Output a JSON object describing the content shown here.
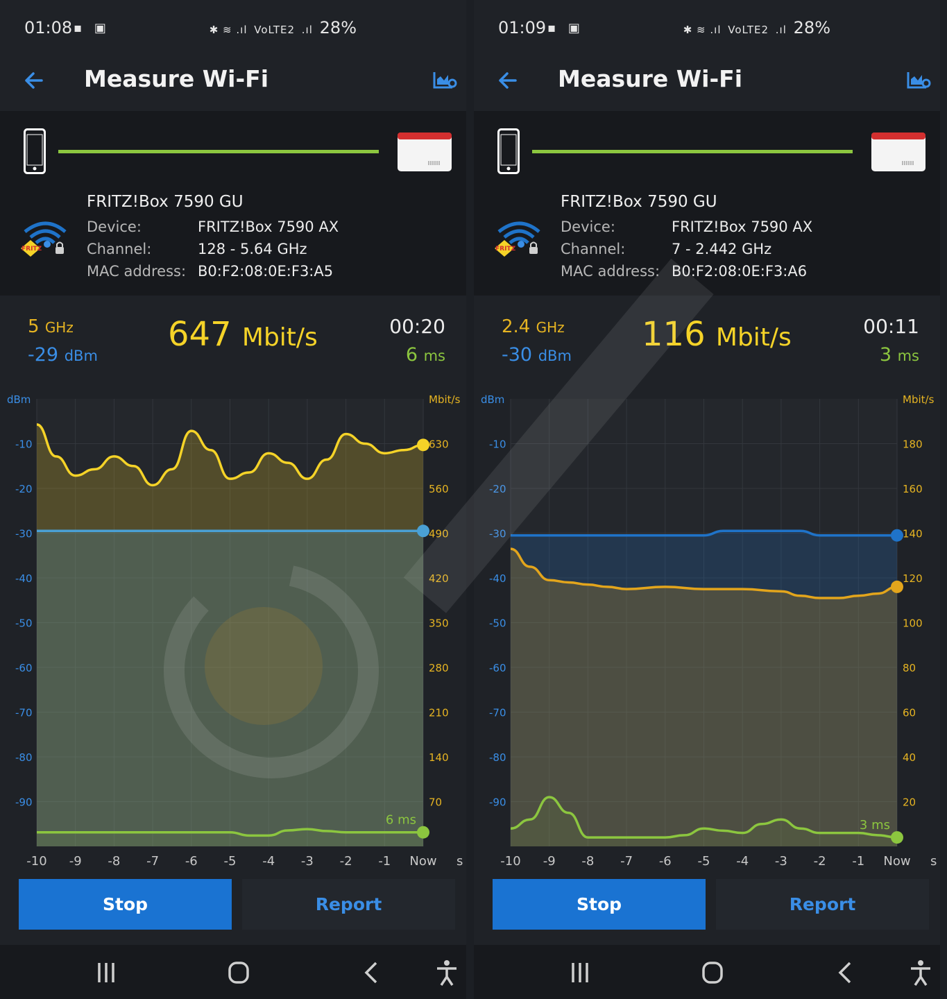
{
  "screens": [
    {
      "status": {
        "time": "01:08",
        "battery": "28%",
        "network": "VoLTE2"
      },
      "app_bar": {
        "title": "Measure Wi-Fi",
        "back_icon": "arrow-left-icon",
        "settings_icon": "chart-settings-icon"
      },
      "connection": {
        "network_name": "FRITZ!Box 7590 GU",
        "device_label": "Device:",
        "device_value": "FRITZ!Box 7590 AX",
        "channel_label": "Channel:",
        "channel_value": "128 - 5.64 GHz",
        "mac_label": "MAC address:",
        "mac_value": "B0:F2:08:0E:F3:A5"
      },
      "metrics": {
        "band_value": "5",
        "band_unit": "GHz",
        "signal_value": "-29",
        "signal_unit": "dBm",
        "rate_value": "647",
        "rate_unit": "Mbit/s",
        "elapsed": "00:20",
        "latency_value": "6",
        "latency_unit": "ms"
      },
      "buttons": {
        "stop": "Stop",
        "report": "Report"
      },
      "chart_data": {
        "type": "line",
        "left_axis_label": "dBm",
        "right_axis_label": "Mbit/s",
        "x_unit_label": "s",
        "x_ticks": [
          "-10",
          "-9",
          "-8",
          "-7",
          "-6",
          "-5",
          "-4",
          "-3",
          "-2",
          "-1",
          "Now"
        ],
        "left_ticks": [
          "-10",
          "-20",
          "-30",
          "-40",
          "-50",
          "-60",
          "-70",
          "-80",
          "-90"
        ],
        "right_ticks": [
          "630",
          "560",
          "490",
          "420",
          "350",
          "280",
          "210",
          "140",
          "70"
        ],
        "left_ylim": [
          -100,
          0
        ],
        "right_ylim": [
          0,
          700
        ],
        "latency_label": "6 ms",
        "series": [
          {
            "axis": "right",
            "color": "#f5d328",
            "x": [
              -10,
              -9.5,
              -9,
              -8.5,
              -8,
              -7.5,
              -7,
              -6.5,
              -6,
              -5.5,
              -5,
              -4.5,
              -4,
              -3.5,
              -3,
              -2.5,
              -2,
              -1.5,
              -1,
              -0.5,
              0
            ],
            "values": [
              660,
              610,
              580,
              590,
              610,
              595,
              565,
              590,
              650,
              620,
              575,
              585,
              615,
              600,
              575,
              605,
              645,
              630,
              615,
              620,
              628
            ]
          },
          {
            "axis": "left",
            "color": "#4aa0d4",
            "x": [
              -10,
              -5,
              0
            ],
            "values": [
              -29.5,
              -29.5,
              -29.5
            ]
          },
          {
            "axis": "right",
            "color": "#8cc63f",
            "x": [
              -10,
              -9,
              -8,
              -7,
              -6,
              -5,
              -4.5,
              -4,
              -3.5,
              -3,
              -2.5,
              -2,
              -1,
              0
            ],
            "values": [
              22,
              22,
              22,
              22,
              22,
              22,
              17,
              17,
              25,
              27,
              24,
              22,
              22,
              22
            ]
          }
        ]
      }
    },
    {
      "status": {
        "time": "01:09",
        "battery": "28%",
        "network": "VoLTE2"
      },
      "app_bar": {
        "title": "Measure Wi-Fi",
        "back_icon": "arrow-left-icon",
        "settings_icon": "chart-settings-icon"
      },
      "connection": {
        "network_name": "FRITZ!Box 7590 GU",
        "device_label": "Device:",
        "device_value": "FRITZ!Box 7590 AX",
        "channel_label": "Channel:",
        "channel_value": "7 - 2.442 GHz",
        "mac_label": "MAC address:",
        "mac_value": "B0:F2:08:0E:F3:A6"
      },
      "metrics": {
        "band_value": "2.4",
        "band_unit": "GHz",
        "signal_value": "-30",
        "signal_unit": "dBm",
        "rate_value": "116",
        "rate_unit": "Mbit/s",
        "elapsed": "00:11",
        "latency_value": "3",
        "latency_unit": "ms"
      },
      "buttons": {
        "stop": "Stop",
        "report": "Report"
      },
      "chart_data": {
        "type": "line",
        "left_axis_label": "dBm",
        "right_axis_label": "Mbit/s",
        "x_unit_label": "s",
        "x_ticks": [
          "-10",
          "-9",
          "-8",
          "-7",
          "-6",
          "-5",
          "-4",
          "-3",
          "-2",
          "-1",
          "Now"
        ],
        "left_ticks": [
          "-10",
          "-20",
          "-30",
          "-40",
          "-50",
          "-60",
          "-70",
          "-80",
          "-90"
        ],
        "right_ticks": [
          "180",
          "160",
          "140",
          "120",
          "100",
          "80",
          "60",
          "40",
          "20"
        ],
        "left_ylim": [
          -100,
          0
        ],
        "right_ylim": [
          0,
          200
        ],
        "latency_label": "3 ms",
        "series": [
          {
            "axis": "left",
            "color": "#1f73c9",
            "x": [
              -10,
              -5,
              -4.5,
              -2.5,
              -2,
              0
            ],
            "values": [
              -30.5,
              -30.5,
              -29.5,
              -29.5,
              -30.5,
              -30.5
            ]
          },
          {
            "axis": "right",
            "color": "#e3a51c",
            "x": [
              -10,
              -9.5,
              -9,
              -8.5,
              -8,
              -7.5,
              -7,
              -6,
              -5,
              -4,
              -3,
              -2.5,
              -2,
              -1.5,
              -1,
              -0.5,
              0
            ],
            "values": [
              133,
              125,
              119,
              118,
              117,
              116,
              115,
              116,
              115,
              115,
              114,
              112,
              111,
              111,
              112,
              113,
              116
            ]
          },
          {
            "axis": "right",
            "color": "#8cc63f",
            "x": [
              -10,
              -9.5,
              -9,
              -8.5,
              -8,
              -7,
              -6,
              -5.5,
              -5,
              -4.5,
              -4,
              -3.5,
              -3,
              -2.5,
              -2,
              -1.5,
              -1,
              -0.5,
              0
            ],
            "values": [
              8,
              12,
              22,
              15,
              4,
              4,
              4,
              5,
              8,
              7,
              6,
              10,
              12,
              8,
              6,
              6,
              6,
              5,
              4
            ]
          }
        ]
      }
    }
  ]
}
